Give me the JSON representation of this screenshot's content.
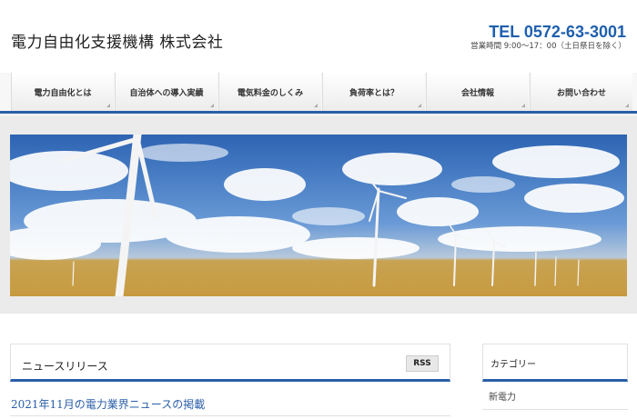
{
  "header": {
    "site_title": "電力自由化支援機構 株式会社",
    "tel": "TEL 0572-63-3001",
    "hours": "営業時間 9:00～17：00（土日祭日を除く）"
  },
  "nav": {
    "items": [
      {
        "label": "電力自由化とは"
      },
      {
        "label": "自治体への導入実績"
      },
      {
        "label": "電気料金のしくみ"
      },
      {
        "label": "負荷率とは？"
      },
      {
        "label": "会社情報"
      },
      {
        "label": "お問い合わせ"
      }
    ]
  },
  "hero": {
    "image_icon": "wind-turbines-landscape",
    "accent": "#2a5fa8"
  },
  "news": {
    "title": "ニュースリリース",
    "rss_label": "RSS",
    "items": [
      {
        "title": "2021年11月の電力業界ニュースの掲載"
      }
    ]
  },
  "sidebar": {
    "category_title": "カテゴリー",
    "categories": [
      {
        "label": "新電力"
      }
    ]
  }
}
